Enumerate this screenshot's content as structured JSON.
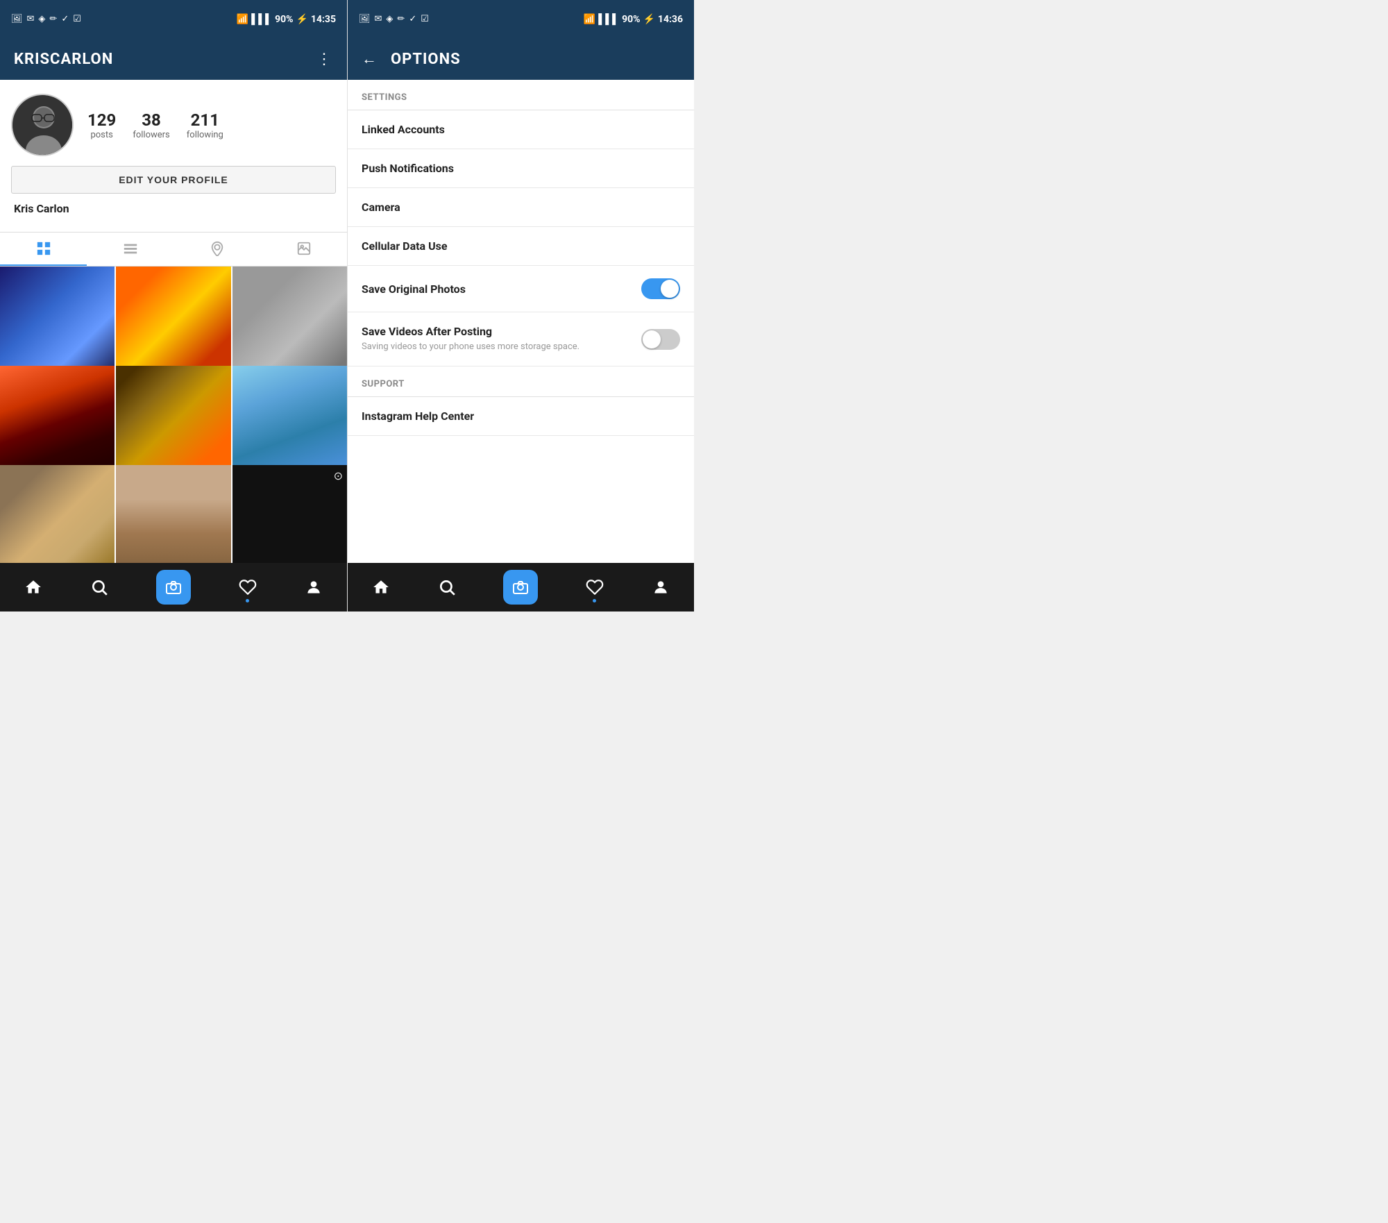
{
  "left": {
    "statusBar": {
      "time": "14:35",
      "battery": "90%"
    },
    "header": {
      "title": "KRISCARLON",
      "moreLabel": "⋮"
    },
    "profile": {
      "stats": [
        {
          "number": "129",
          "label": "posts"
        },
        {
          "number": "38",
          "label": "followers"
        },
        {
          "number": "211",
          "label": "following"
        }
      ],
      "editButtonLabel": "EDIT YOUR PROFILE",
      "name": "Kris Carlon"
    },
    "nav": {
      "items": [
        "home",
        "search",
        "camera",
        "heart",
        "person"
      ]
    }
  },
  "right": {
    "statusBar": {
      "time": "14:36",
      "battery": "90%"
    },
    "header": {
      "backLabel": "←",
      "title": "OPTIONS"
    },
    "settings": {
      "sectionHeader": "SETTINGS",
      "items": [
        {
          "label": "Linked Accounts",
          "type": "link"
        },
        {
          "label": "Push Notifications",
          "type": "link"
        },
        {
          "label": "Camera",
          "type": "link"
        },
        {
          "label": "Cellular Data Use",
          "type": "link"
        },
        {
          "label": "Save Original Photos",
          "type": "toggle",
          "value": true
        },
        {
          "label": "Save Videos After Posting",
          "type": "toggle",
          "value": false,
          "sub": "Saving videos to your phone uses more storage space."
        }
      ],
      "supportHeader": "SUPPORT",
      "supportItems": [
        {
          "label": "Instagram Help Center",
          "type": "link"
        }
      ]
    }
  }
}
